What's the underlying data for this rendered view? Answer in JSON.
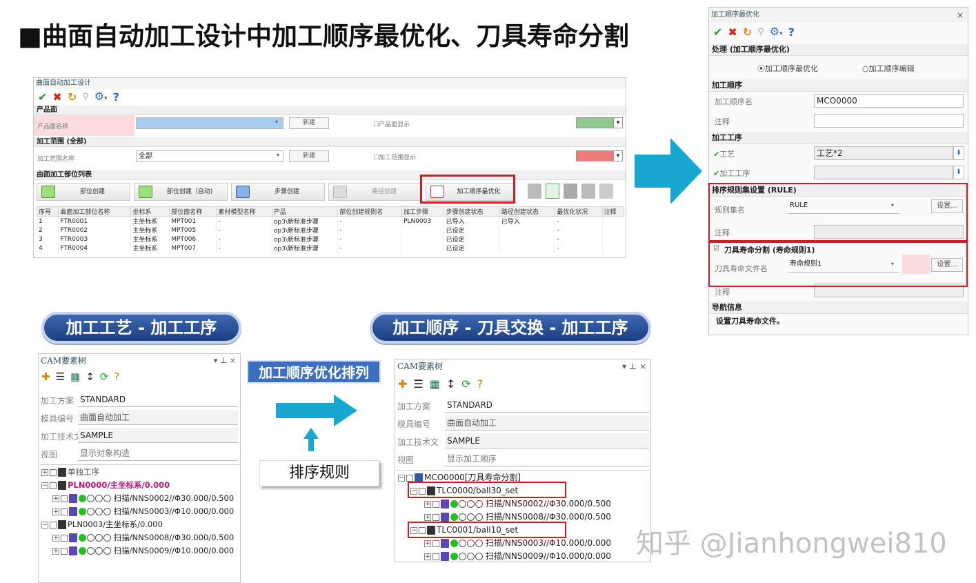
{
  "slide": {
    "title": "■曲面自动加工设计中加工顺序最优化、刀具寿命分割"
  },
  "design_window": {
    "caption": "曲面自动加工设计",
    "sections": {
      "product": "产品面",
      "range": "加工范围 (全部)",
      "list": "曲面加工部位列表"
    },
    "product_name_label": "产品面名称",
    "product_name_value": "",
    "new_label": "新建",
    "product_display": "产品面显示",
    "range_name_label": "加工范围名称",
    "range_value": "全部",
    "range_display": "加工范围显示",
    "buttons": {
      "part_create": "部位创建",
      "part_create_auto": "部位创建（自动)",
      "step_create": "步骤创建",
      "path_create": "路径创建",
      "order_opt": "加工顺序最优化"
    },
    "columns": [
      "序号",
      "曲面加工部位名称",
      "坐标系",
      "部位面名称",
      "素材模型名称",
      "产品",
      "部位创建规则名",
      "加工步骤",
      "步骤创建状态",
      "路径创建状态",
      "最优化状况",
      "注释"
    ],
    "rows": [
      [
        "1",
        "FTR0001",
        "主坐标系",
        "MPT001",
        "-",
        "op3\\新标准步骤",
        "-",
        "PLN0003",
        "已导入",
        "已导入",
        "-",
        ""
      ],
      [
        "2",
        "FTR0002",
        "主坐标系",
        "MPT005",
        "-",
        "op3\\新标准步骤",
        "-",
        "",
        "已设定",
        "",
        "-",
        ""
      ],
      [
        "3",
        "FTR0003",
        "主坐标系",
        "MPT006",
        "-",
        "op3\\新标准步骤",
        "-",
        "",
        "已设定",
        "",
        "-",
        ""
      ],
      [
        "4",
        "FTR0004",
        "主坐标系",
        "MPT007",
        "-",
        "op3\\新标准步骤",
        "-",
        "",
        "已设定",
        "",
        "-",
        ""
      ]
    ],
    "colors": {
      "green_swatch": "#8fc98f",
      "red_swatch": "#f07b7b"
    }
  },
  "order_panel": {
    "caption": "加工顺序最优化",
    "sections": {
      "process": "处理 (加工顺序最优化)",
      "order": "加工顺序",
      "ops": "加工工序",
      "rule": "排序规则集设置 (RULE)",
      "tool": "刀具寿命分割 (寿命规则1)",
      "nav": "导航信息"
    },
    "radio_opt": "加工顺序最优化",
    "radio_edit": "加工顺序编辑",
    "order_name_label": "加工顺序名",
    "order_name_value": "MCO0000",
    "note_label": "注释",
    "process_label": "工艺",
    "process_value": "工艺*2",
    "op_label": "加工工序",
    "ruleset_label": "规则集名",
    "ruleset_value": "RULE",
    "setting_label": "设置...",
    "tool_file_label": "刀具寿命文件名",
    "tool_file_value": "寿命规则1",
    "nav_text": "设置刀具寿命文件。"
  },
  "banners": {
    "left": "加工工艺 - 加工工序",
    "right": "加工顺序 - 刀具交换 - 加工工序",
    "middle": "加工顺序优化排列",
    "rule": "排序规则"
  },
  "cam_left": {
    "header": "CAM要素树",
    "fields": [
      {
        "k": "加工方案",
        "v": "STANDARD"
      },
      {
        "k": "模具编号",
        "v": "曲面自动加工"
      },
      {
        "k": "加工技术文",
        "v": "SAMPLE"
      },
      {
        "k": "视图",
        "v": "显示对象构造"
      }
    ],
    "nodes": [
      "单独工序",
      "PLN0000/主坐标系/0.000",
      "扫描/NNS0002//Φ30.000/0.500",
      "扫描/NNS0003//Φ10.000/0.000",
      "PLN0003/主坐标系/0.000",
      "扫描/NNS0008//Φ30.000/0.500",
      "扫描/NNS0009//Φ10.000/0.000"
    ]
  },
  "cam_right": {
    "header": "CAM要素树",
    "fields": [
      {
        "k": "加工方案",
        "v": "STANDARD"
      },
      {
        "k": "模具编号",
        "v": "曲面自动加工"
      },
      {
        "k": "加工技术文",
        "v": "SAMPLE"
      },
      {
        "k": "视图",
        "v": "显示加工顺序"
      }
    ],
    "nodes": [
      "MCO0000[刀具寿命分割]",
      "TLC0000/ball30_set",
      "扫描/NNS0002//Φ30.000/0.500",
      "扫描/NNS0008//Φ30.000/0.500",
      "TLC0001/ball10_set",
      "扫描/NNS0003//Φ10.000/0.000",
      "扫描/NNS0009//Φ10.000/0.000"
    ]
  },
  "watermark": "知乎 @Jianhongwei810",
  "icons": [
    "check-icon",
    "close-icon",
    "undo-icon",
    "search-icon",
    "gear-icon",
    "help-icon"
  ]
}
